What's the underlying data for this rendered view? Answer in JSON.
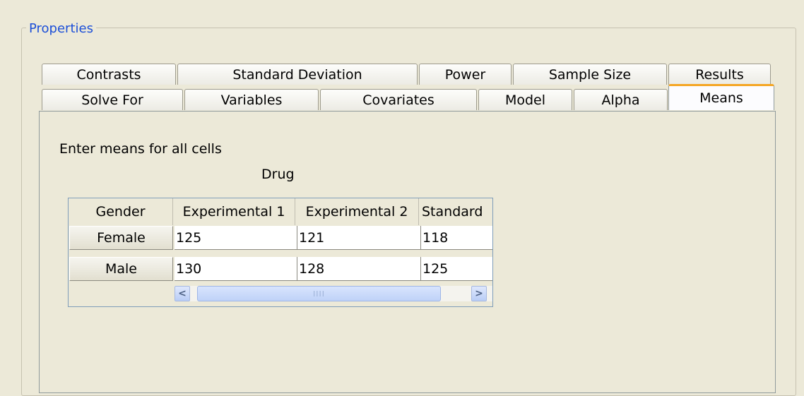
{
  "group": {
    "title": "Properties"
  },
  "tabs_row1": [
    "Contrasts",
    "Standard Deviation",
    "Power",
    "Sample Size",
    "Results"
  ],
  "tabs_row2": [
    "Solve For",
    "Variables",
    "Covariates",
    "Model",
    "Alpha",
    "Means"
  ],
  "active_tab": "Means",
  "panel": {
    "instruction": "Enter means for all cells",
    "factor_label": "Drug"
  },
  "table": {
    "columns": [
      "Gender",
      "Experimental 1",
      "Experimental 2",
      "Standard"
    ],
    "rows": [
      {
        "label": "Female",
        "values": [
          "125",
          "121",
          "118"
        ]
      },
      {
        "label": "Male",
        "values": [
          "130",
          "128",
          "125"
        ]
      }
    ]
  },
  "scrollbar": {
    "left_arrow": "<",
    "right_arrow": ">",
    "grip": "IIII"
  },
  "colors": {
    "accent": "#f5a623",
    "title": "#1c4fd8",
    "background": "#ece9d8"
  }
}
